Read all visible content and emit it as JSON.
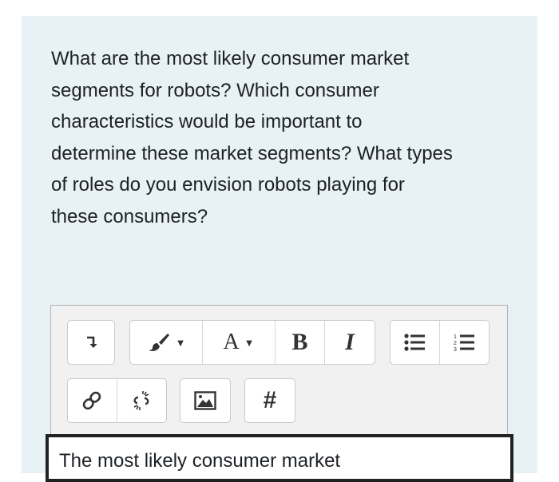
{
  "question": {
    "lines": [
      "What are the most likely consumer market",
      "segments for robots? Which consumer",
      "characteristics would be important to",
      "determine these market segments? What types",
      "of roles do you envision robots playing for",
      "these consumers?"
    ]
  },
  "toolbar": {
    "expand_icon": "collapse-arrow-icon",
    "paint_icon": "paint-brush-icon",
    "font_color_label": "A",
    "bold_label": "B",
    "italic_label": "I",
    "bullet_list_icon": "unordered-list-icon",
    "numbered_list_icon": "ordered-list-icon",
    "link_icon": "link-icon",
    "unlink_icon": "unlink-icon",
    "image_icon": "image-icon",
    "hash_label": "#"
  },
  "answer": {
    "text": "The most likely consumer market"
  }
}
